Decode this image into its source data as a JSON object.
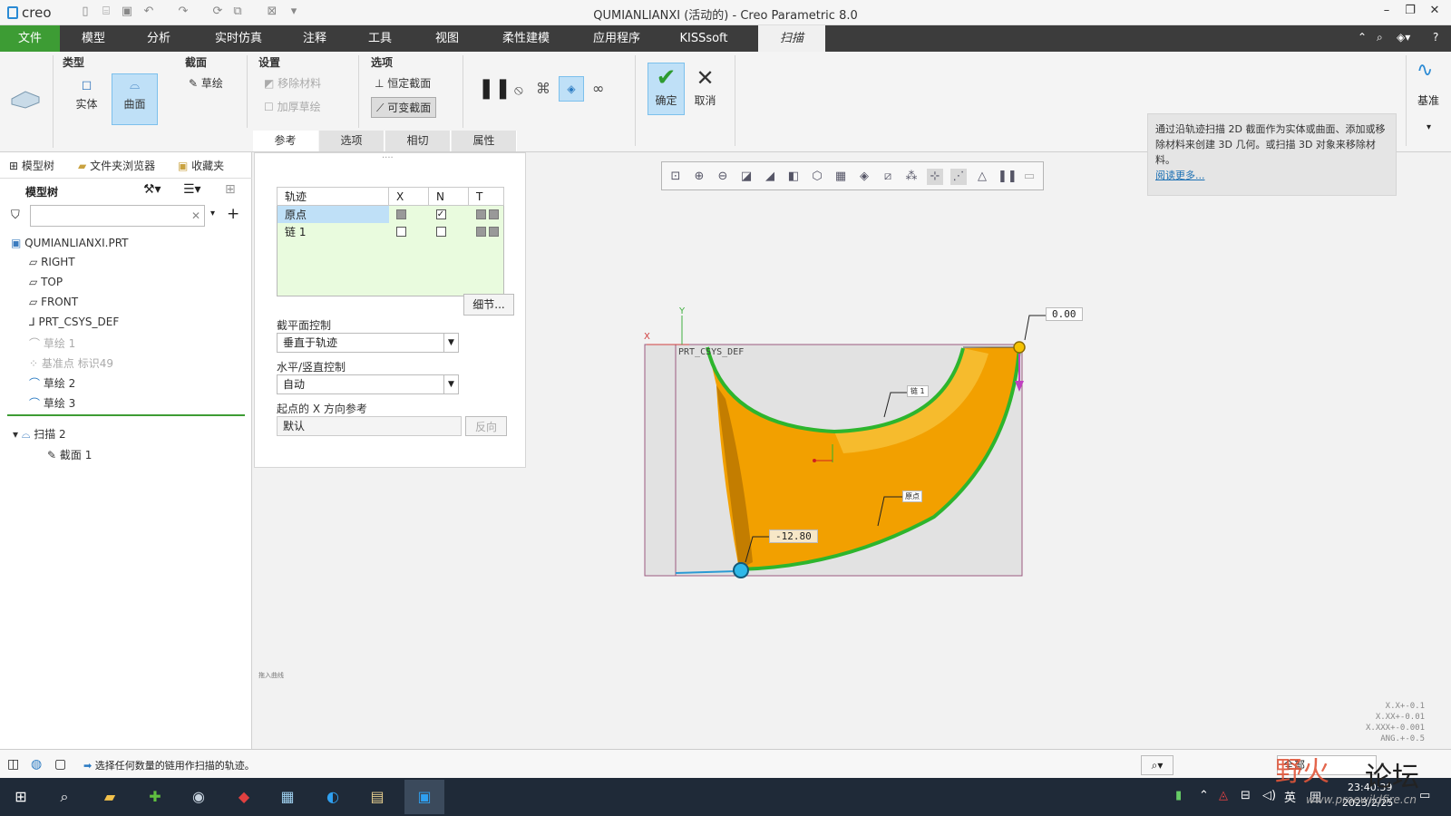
{
  "titlebar": {
    "app_logo": "creo",
    "window_title": "QUMIANLIANXI (活动的) - Creo Parametric 8.0"
  },
  "menubar": {
    "items": [
      "文件",
      "模型",
      "分析",
      "实时仿真",
      "注释",
      "工具",
      "视图",
      "柔性建模",
      "应用程序",
      "KISSsoft",
      "扫描"
    ]
  },
  "ribbon": {
    "type_group": {
      "title": "类型",
      "solid": "实体",
      "surface": "曲面"
    },
    "section_group": {
      "title": "截面",
      "sketch": "草绘"
    },
    "settings_group": {
      "title": "设置",
      "remove_material": "移除材料",
      "thicken_sketch": "加厚草绘"
    },
    "options_group": {
      "title": "选项",
      "constant_section": "恒定截面",
      "variable_section": "可变截面"
    },
    "ok": "确定",
    "cancel": "取消",
    "datum": "基准",
    "subtabs": [
      "参考",
      "选项",
      "相切",
      "属性"
    ],
    "info": {
      "text": "通过沿轨迹扫描 2D 截面作为实体或曲面、添加或移除材料来创建 3D 几何。或扫描 3D 对象来移除材料。",
      "link": "阅读更多..."
    }
  },
  "left_panel": {
    "tabs": [
      "模型树",
      "文件夹浏览器",
      "收藏夹"
    ],
    "header": "模型树",
    "items": [
      "QUMIANLIANXI.PRT",
      "RIGHT",
      "TOP",
      "FRONT",
      "PRT_CSYS_DEF",
      "草绘 1",
      "基准点 标识49",
      "草绘 2",
      "草绘 3",
      "扫描 2",
      "截面 1"
    ]
  },
  "ref_panel": {
    "table_headers": [
      "轨迹",
      "X",
      "N",
      "T"
    ],
    "rows": [
      {
        "name": "原点",
        "x": "gray",
        "n": "checked"
      },
      {
        "name": "链 1",
        "x": "empty",
        "n": "empty"
      }
    ],
    "details_button": "细节...",
    "section_plane_label": "截平面控制",
    "section_plane_value": "垂直于轨迹",
    "hv_label": "水平/竖直控制",
    "hv_value": "自动",
    "xdir_label": "起点的 X 方向参考",
    "xdir_value": "默认",
    "flip_button": "反向"
  },
  "graphics": {
    "csys_label": "PRT_CSYS_DEF",
    "dim_top": "0.00",
    "dim_bottom": "-12.80",
    "chain_label": "链 1",
    "origin_label": "原点",
    "axis_x": "X",
    "axis_y": "Y",
    "small_note": "拖入曲线",
    "accuracy": [
      "X.X+-0.1",
      "X.XX+-0.01",
      "X.XXX+-0.001",
      "ANG.+-0.5"
    ]
  },
  "statusbar": {
    "message": "选择任何数量的链用作扫描的轨迹。",
    "filter": "全部"
  },
  "taskbar": {
    "ime": "英",
    "time": "23:40:39",
    "date": "2023/2/25"
  },
  "watermark": {
    "text1": "野火",
    "text2": "论坛",
    "url": "www.proewildfire.cn"
  },
  "colors": {
    "accent": "#3d9c34",
    "surface": "#f5a300",
    "edge": "#2db52d",
    "selection": "#bfe0f7"
  }
}
